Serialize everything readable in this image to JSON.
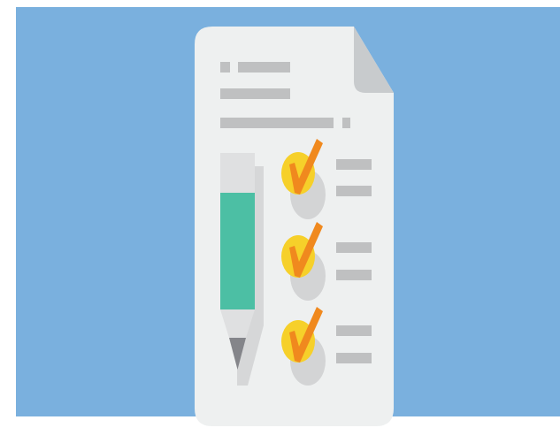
{
  "illustration": {
    "subject": "checklist-document",
    "checklist_item_count": 3,
    "checked_item_count": 3,
    "colors": {
      "background": "#7ab0de",
      "paper": "#eef0f0",
      "paper_fold": "#c8cbcd",
      "text_lines": "#bfc0c1",
      "check_circle": "#f6d02a",
      "check_shadow": "#d3d4d5",
      "check_mark": "#f0891e",
      "pencil_body": "#4cbfa4",
      "pencil_cap": "#dfe0e1",
      "pencil_tip": "#84858a",
      "pencil_shadow": "#d6d7d8"
    },
    "icons": [
      "document-icon",
      "pencil-icon",
      "checkmark-icon"
    ]
  }
}
